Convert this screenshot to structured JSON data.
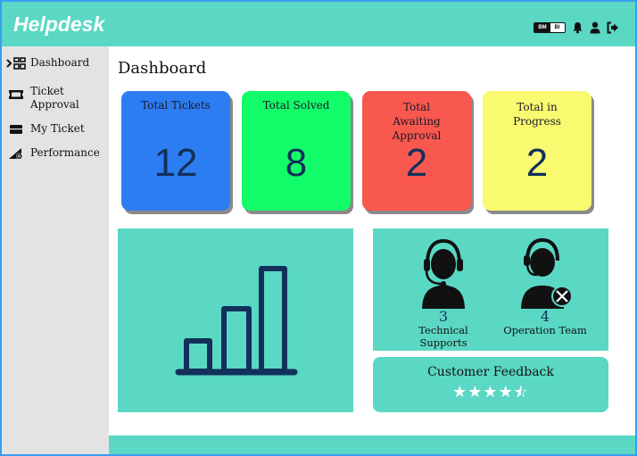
{
  "app": {
    "title": "Helpdesk"
  },
  "header": {
    "lang_bm": "BM",
    "lang_bi": "BI"
  },
  "sidebar": {
    "items": [
      {
        "label": "Dashboard",
        "icon": "dashboard-icon"
      },
      {
        "label": "Ticket Approval",
        "icon": "ticket-icon"
      },
      {
        "label": "My Ticket",
        "icon": "my-ticket-icon"
      },
      {
        "label": "Performance",
        "icon": "performance-icon"
      }
    ]
  },
  "main": {
    "title": "Dashboard",
    "cards": [
      {
        "title": "Total Tickets",
        "value": "12",
        "color": "#2d7df2"
      },
      {
        "title": "Total Solved",
        "value": "8",
        "color": "#12fc6a"
      },
      {
        "title": "Total Awaiting Approval",
        "value": "2",
        "color": "#f9584e"
      },
      {
        "title": "Total in Progress",
        "value": "2",
        "color": "#fafa70"
      }
    ],
    "teams": [
      {
        "count": "3",
        "name": "Technical Supports"
      },
      {
        "count": "4",
        "name": "Operation Team"
      }
    ],
    "feedback": {
      "title": "Customer Feedback",
      "rating": 4.5,
      "max": 5
    }
  },
  "colors": {
    "accent": "#5ad8c4",
    "navy": "#12305a"
  }
}
